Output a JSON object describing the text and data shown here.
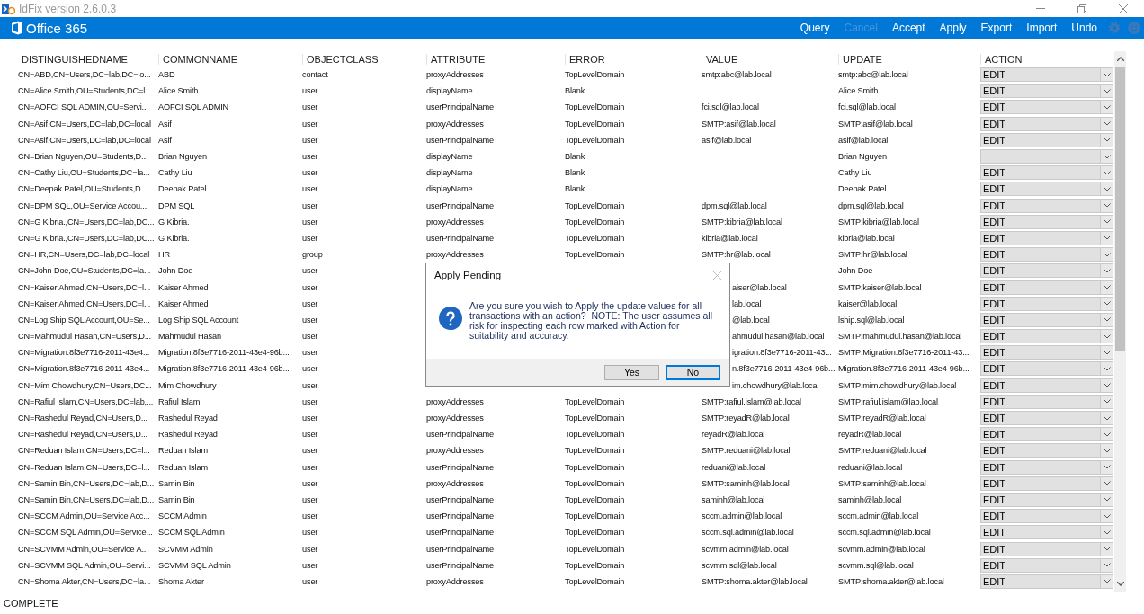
{
  "window": {
    "title": "IdFix version 2.6.0.3"
  },
  "header": {
    "logo_text": "Office 365",
    "menu": [
      {
        "label": "Query",
        "disabled": false
      },
      {
        "label": "Cancel",
        "disabled": true
      },
      {
        "label": "Accept",
        "disabled": false
      },
      {
        "label": "Apply",
        "disabled": false
      },
      {
        "label": "Export",
        "disabled": false
      },
      {
        "label": "Import",
        "disabled": false
      },
      {
        "label": "Undo",
        "disabled": false
      }
    ]
  },
  "table": {
    "columns": [
      "DISTINGUISHEDNAME",
      "COMMONNAME",
      "OBJECTCLASS",
      "ATTRIBUTE",
      "ERROR",
      "VALUE",
      "UPDATE",
      "ACTION"
    ],
    "rows": [
      {
        "dn": "CN=ABD,CN=Users,DC=lab,DC=lo...",
        "cn": "ABD",
        "objectclass": "contact",
        "attribute": "proxyAddresses",
        "error": "TopLevelDomain",
        "value": "smtp:abc@lab.local",
        "update": "smtp:abc@lab.local",
        "action": "EDIT"
      },
      {
        "dn": "CN=Alice Smith,OU=Students,DC=l...",
        "cn": "Alice Smith",
        "objectclass": "user",
        "attribute": "displayName",
        "error": "Blank",
        "update": "Alice Smith",
        "action": "EDIT"
      },
      {
        "dn": "CN=AOFCI SQL ADMIN,OU=Servi...",
        "cn": "AOFCI SQL ADMIN",
        "objectclass": "user",
        "attribute": "userPrincipalName",
        "error": "TopLevelDomain",
        "value": "fci.sql@lab.local",
        "update": "fci.sql@lab.local",
        "action": "EDIT"
      },
      {
        "dn": "CN=Asif,CN=Users,DC=lab,DC=local",
        "cn": "Asif",
        "objectclass": "user",
        "attribute": "proxyAddresses",
        "error": "TopLevelDomain",
        "value": "SMTP:asif@lab.local",
        "update": "SMTP:asif@lab.local",
        "action": "EDIT"
      },
      {
        "dn": "CN=Asif,CN=Users,DC=lab,DC=local",
        "cn": "Asif",
        "objectclass": "user",
        "attribute": "userPrincipalName",
        "error": "TopLevelDomain",
        "value": "asif@lab.local",
        "update": "asif@lab.local",
        "action": "EDIT"
      },
      {
        "dn": "CN=Brian Nguyen,OU=Students,D...",
        "cn": "Brian Nguyen",
        "objectclass": "user",
        "attribute": "displayName",
        "error": "Blank",
        "update": "Brian Nguyen"
      },
      {
        "dn": "CN=Cathy Liu,OU=Students,DC=la...",
        "cn": "Cathy Liu",
        "objectclass": "user",
        "attribute": "displayName",
        "error": "Blank",
        "update": "Cathy Liu",
        "action": "EDIT"
      },
      {
        "dn": "CN=Deepak Patel,OU=Students,D...",
        "cn": "Deepak Patel",
        "objectclass": "user",
        "attribute": "displayName",
        "error": "Blank",
        "update": "Deepak Patel",
        "action": "EDIT"
      },
      {
        "dn": "CN=DPM SQL,OU=Service Accou...",
        "cn": "DPM SQL",
        "objectclass": "user",
        "attribute": "userPrincipalName",
        "error": "TopLevelDomain",
        "value": "dpm.sql@lab.local",
        "update": "dpm.sql@lab.local",
        "action": "EDIT"
      },
      {
        "dn": "CN=G Kibria.,CN=Users,DC=lab,DC...",
        "cn": "G Kibria.",
        "objectclass": "user",
        "attribute": "proxyAddresses",
        "error": "TopLevelDomain",
        "value": "SMTP:kibria@lab.local",
        "update": "SMTP:kibria@lab.local",
        "action": "EDIT"
      },
      {
        "dn": "CN=G Kibria.,CN=Users,DC=lab,DC...",
        "cn": "G Kibria.",
        "objectclass": "user",
        "attribute": "userPrincipalName",
        "error": "TopLevelDomain",
        "value": "kibria@lab.local",
        "update": "kibria@lab.local",
        "action": "EDIT"
      },
      {
        "dn": "CN=HR,CN=Users,DC=lab,DC=local",
        "cn": "HR",
        "objectclass": "group",
        "attribute": "proxyAddresses",
        "error": "TopLevelDomain",
        "value": "SMTP:hr@lab.local",
        "update": "SMTP:hr@lab.local",
        "action": "EDIT"
      },
      {
        "dn": "CN=John Doe,OU=Students,DC=la...",
        "cn": "John Doe",
        "objectclass": "user",
        "update": "John Doe",
        "action": "EDIT"
      },
      {
        "dn": "CN=Kaiser Ahmed,CN=Users,DC=l...",
        "cn": "Kaiser Ahmed",
        "objectclass": "user",
        "value_partial": "aiser@lab.local",
        "update": "SMTP:kaiser@lab.local",
        "action": "EDIT"
      },
      {
        "dn": "CN=Kaiser Ahmed,CN=Users,DC=l...",
        "cn": "Kaiser Ahmed",
        "objectclass": "user",
        "value_partial": "lab.local",
        "update": "kaiser@lab.local",
        "action": "EDIT"
      },
      {
        "dn": "CN=Log Ship SQL Account,OU=Se...",
        "cn": "Log Ship SQL Account",
        "objectclass": "user",
        "value_partial": "@lab.local",
        "update": "lship.sql@lab.local",
        "action": "EDIT"
      },
      {
        "dn": "CN=Mahmudul Hasan,CN=Users,D...",
        "cn": "Mahmudul Hasan",
        "objectclass": "user",
        "value_partial": "ahmudul.hasan@lab.local",
        "update": "SMTP:mahmudul.hasan@lab.local",
        "action": "EDIT"
      },
      {
        "dn": "CN=Migration.8f3e7716-2011-43e4...",
        "cn": "Migration.8f3e7716-2011-43e4-96b...",
        "objectclass": "user",
        "value_partial": "igration.8f3e7716-2011-43...",
        "update": "SMTP:Migration.8f3e7716-2011-43...",
        "action": "EDIT"
      },
      {
        "dn": "CN=Migration.8f3e7716-2011-43e4...",
        "cn": "Migration.8f3e7716-2011-43e4-96b...",
        "objectclass": "user",
        "value_partial": "n.8f3e7716-2011-43e4-96b...",
        "update": "Migration.8f3e7716-2011-43e4-96b...",
        "action": "EDIT"
      },
      {
        "dn": "CN=Mim Chowdhury,CN=Users,DC...",
        "cn": "Mim Chowdhury",
        "objectclass": "user",
        "value_partial": "im.chowdhury@lab.local",
        "update": "SMTP:mim.chowdhury@lab.local",
        "action": "EDIT"
      },
      {
        "dn": "CN=Rafiul Islam,CN=Users,DC=lab,...",
        "cn": "Rafiul Islam",
        "objectclass": "user",
        "attribute": "proxyAddresses",
        "error": "TopLevelDomain",
        "value": "SMTP:rafiul.islam@lab.local",
        "update": "SMTP:rafiul.islam@lab.local",
        "action": "EDIT"
      },
      {
        "dn": "CN=Rashedul Reyad,CN=Users,D...",
        "cn": "Rashedul Reyad",
        "objectclass": "user",
        "attribute": "proxyAddresses",
        "error": "TopLevelDomain",
        "value": "SMTP:reyadR@lab.local",
        "update": "SMTP:reyadR@lab.local",
        "action": "EDIT"
      },
      {
        "dn": "CN=Rashedul Reyad,CN=Users,D...",
        "cn": "Rashedul Reyad",
        "objectclass": "user",
        "attribute": "userPrincipalName",
        "error": "TopLevelDomain",
        "value": "reyadR@lab.local",
        "update": "reyadR@lab.local",
        "action": "EDIT"
      },
      {
        "dn": "CN=Reduan Islam,CN=Users,DC=l...",
        "cn": "Reduan Islam",
        "objectclass": "user",
        "attribute": "proxyAddresses",
        "error": "TopLevelDomain",
        "value": "SMTP:reduani@lab.local",
        "update": "SMTP:reduani@lab.local",
        "action": "EDIT"
      },
      {
        "dn": "CN=Reduan Islam,CN=Users,DC=l...",
        "cn": "Reduan Islam",
        "objectclass": "user",
        "attribute": "userPrincipalName",
        "error": "TopLevelDomain",
        "value": "reduani@lab.local",
        "update": "reduani@lab.local",
        "action": "EDIT"
      },
      {
        "dn": "CN=Samin Bin,CN=Users,DC=lab,D...",
        "cn": "Samin Bin",
        "objectclass": "user",
        "attribute": "proxyAddresses",
        "error": "TopLevelDomain",
        "value": "SMTP:saminh@lab.local",
        "update": "SMTP:saminh@lab.local",
        "action": "EDIT"
      },
      {
        "dn": "CN=Samin Bin,CN=Users,DC=lab,D...",
        "cn": "Samin Bin",
        "objectclass": "user",
        "attribute": "userPrincipalName",
        "error": "TopLevelDomain",
        "value": "saminh@lab.local",
        "update": "saminh@lab.local",
        "action": "EDIT"
      },
      {
        "dn": "CN=SCCM Admin,OU=Service Acc...",
        "cn": "SCCM Admin",
        "objectclass": "user",
        "attribute": "userPrincipalName",
        "error": "TopLevelDomain",
        "value": "sccm.admin@lab.local",
        "update": "sccm.admin@lab.local",
        "action": "EDIT"
      },
      {
        "dn": "CN=SCCM SQL Admin,OU=Service...",
        "cn": "SCCM SQL Admin",
        "objectclass": "user",
        "attribute": "userPrincipalName",
        "error": "TopLevelDomain",
        "value": "sccm.sql.admin@lab.local",
        "update": "sccm.sql.admin@lab.local",
        "action": "EDIT"
      },
      {
        "dn": "CN=SCVMM Admin,OU=Service A...",
        "cn": "SCVMM Admin",
        "objectclass": "user",
        "attribute": "userPrincipalName",
        "error": "TopLevelDomain",
        "value": "scvmm.admin@lab.local",
        "update": "scvmm.admin@lab.local",
        "action": "EDIT"
      },
      {
        "dn": "CN=SCVMM SQL Admin,OU=Servi...",
        "cn": "SCVMM SQL Admin",
        "objectclass": "user",
        "attribute": "userPrincipalName",
        "error": "TopLevelDomain",
        "value": "scvmm.sql@lab.local",
        "update": "scvmm.sql@lab.local",
        "action": "EDIT"
      },
      {
        "dn": "CN=Shoma Akter,CN=Users,DC=la...",
        "cn": "Shoma Akter",
        "objectclass": "user",
        "attribute": "proxyAddresses",
        "error": "TopLevelDomain",
        "value": "SMTP:shoma.akter@lab.local",
        "update": "SMTP:shoma.akter@lab.local",
        "action": "EDIT"
      }
    ]
  },
  "dialog": {
    "title": "Apply Pending",
    "message": "Are you sure you wish to Apply the update values for all transactions with an action?  NOTE: The user assumes all risk for inspecting each row marked with Action for suitability and accuracy.",
    "buttons": [
      {
        "label": "Yes",
        "focused": false
      },
      {
        "label": "No",
        "focused": true
      }
    ]
  },
  "status_bar": {
    "text": "COMPLETE"
  }
}
